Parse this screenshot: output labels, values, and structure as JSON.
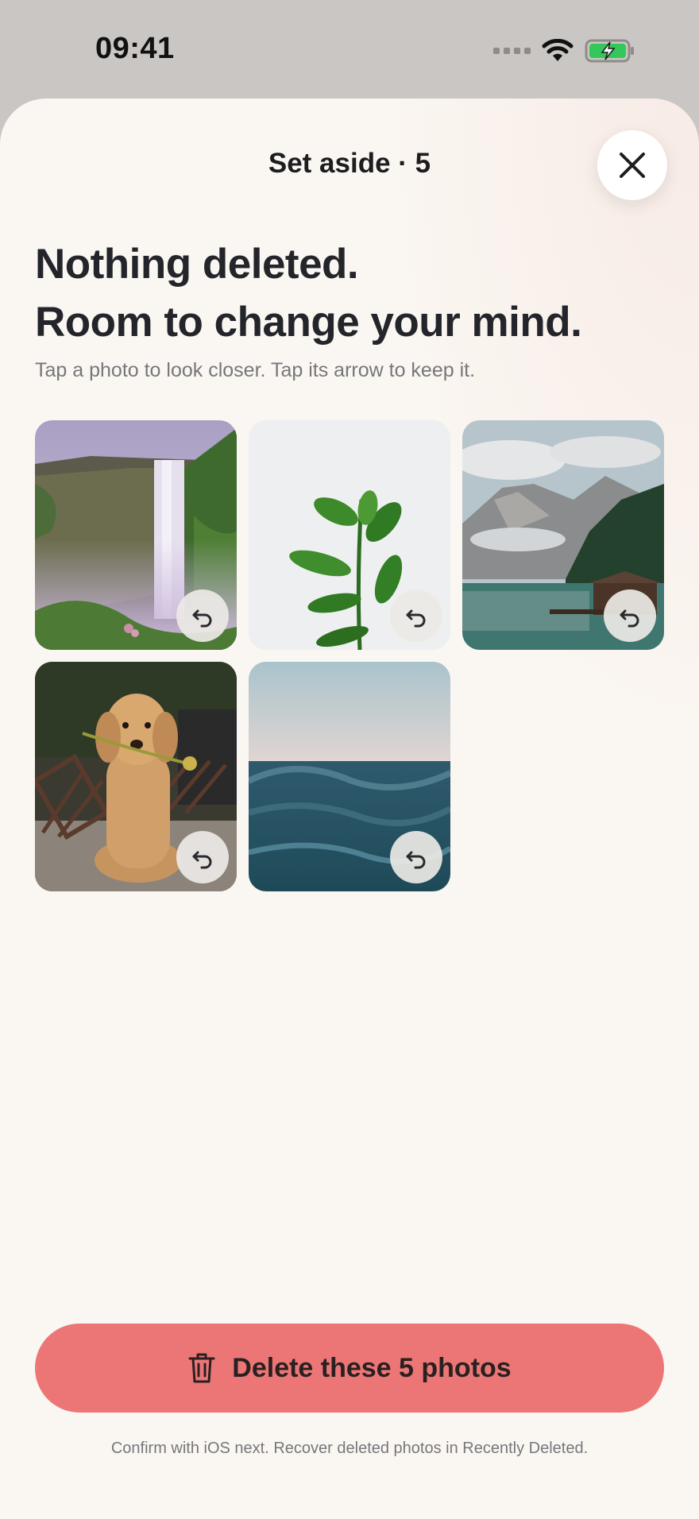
{
  "status_bar": {
    "time": "09:41",
    "icons": [
      "signal-dots-icon",
      "wifi-icon",
      "battery-charging-icon"
    ],
    "battery_color": "#34c759"
  },
  "sheet": {
    "title": "Set aside · 5",
    "close_icon": "close-icon"
  },
  "headline": {
    "line1": "Nothing deleted.",
    "line2": "Room to change your mind."
  },
  "subtitle": "Tap a photo to look closer. Tap its arrow to keep it.",
  "photos": [
    {
      "subject": "waterfall",
      "action_icon": "undo-arrow-icon"
    },
    {
      "subject": "plant",
      "action_icon": "undo-arrow-icon"
    },
    {
      "subject": "mountain-lake",
      "action_icon": "undo-arrow-icon"
    },
    {
      "subject": "dog",
      "action_icon": "undo-arrow-icon"
    },
    {
      "subject": "ocean",
      "action_icon": "undo-arrow-icon"
    }
  ],
  "delete_button": {
    "label": "Delete these 5 photos",
    "icon": "trash-icon",
    "color": "#ec7676"
  },
  "footnote": "Confirm with iOS next. Recover deleted photos in Recently Deleted."
}
